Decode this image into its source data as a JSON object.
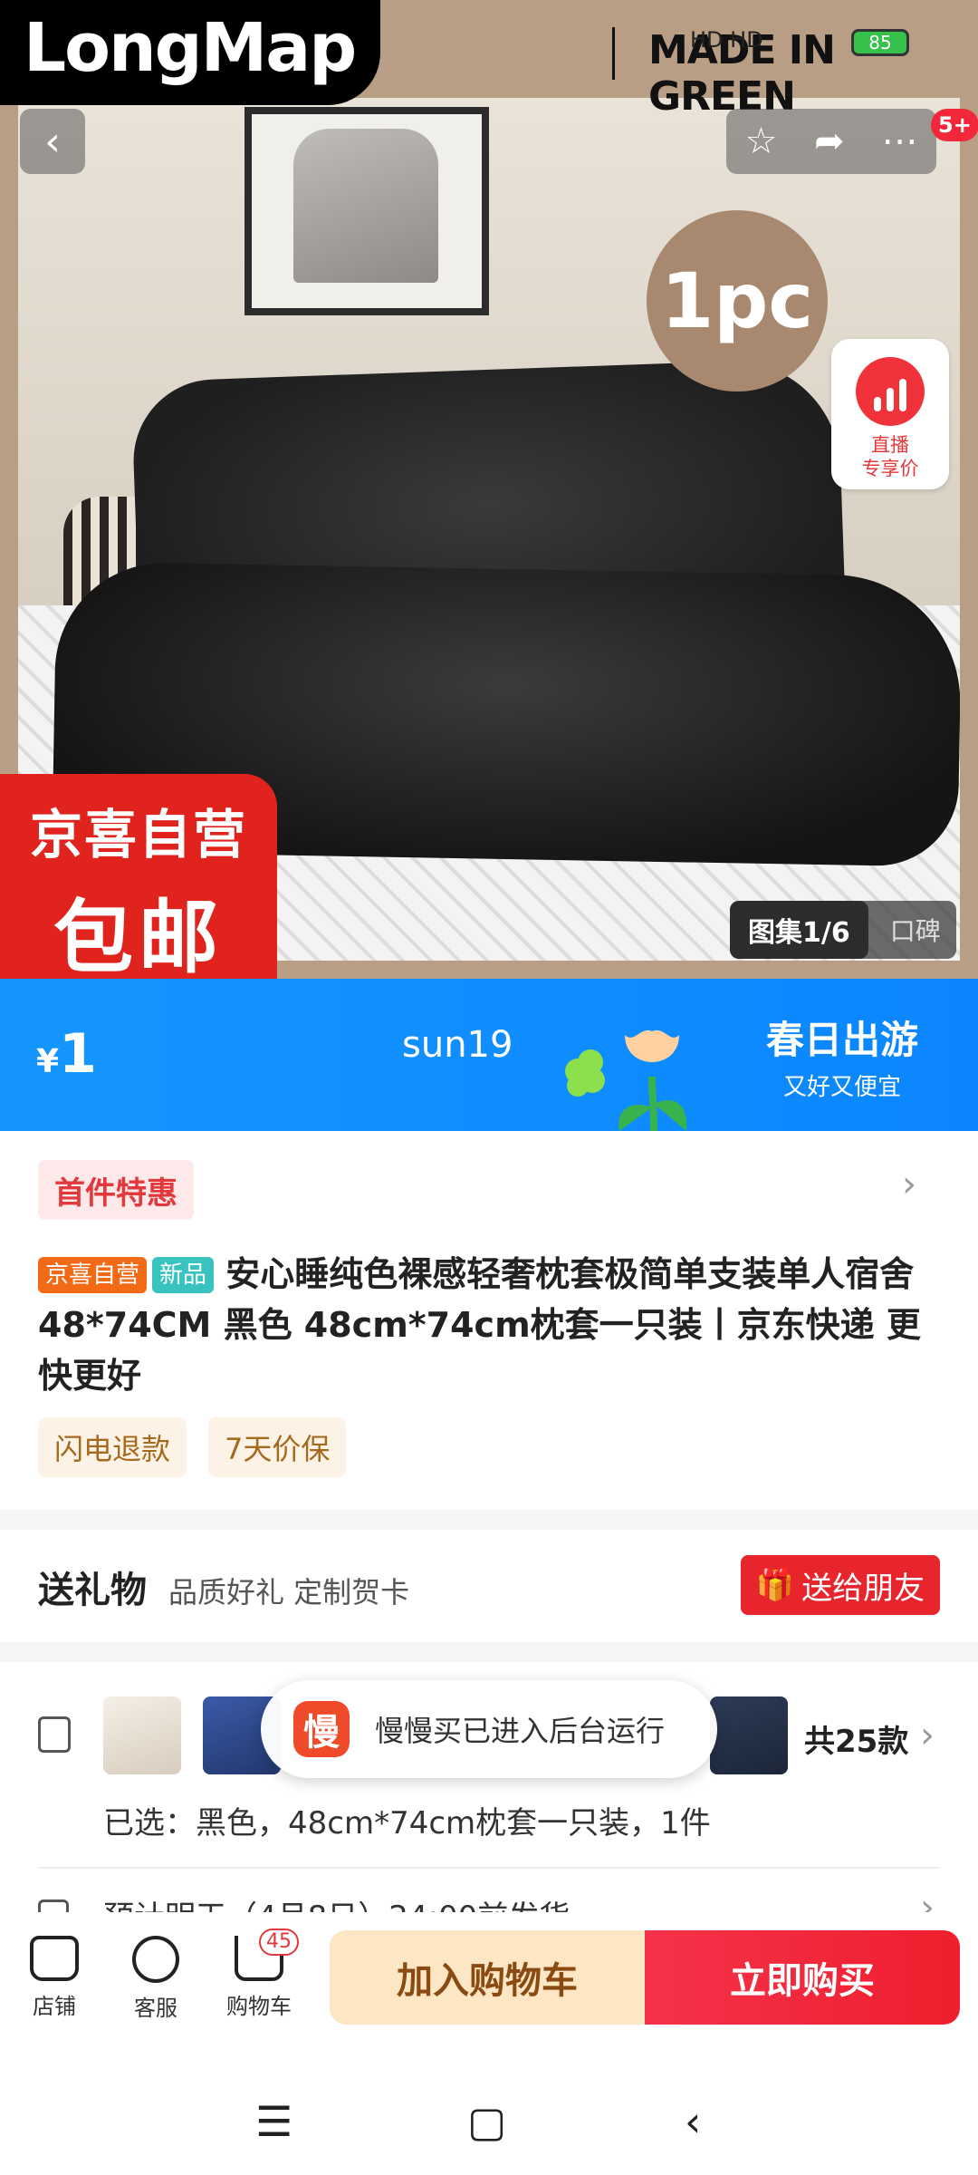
{
  "status_bar": {
    "logo_text": "LongMap",
    "made_in_green": "MADE IN GREEN",
    "network_icons": "HD HD",
    "battery": "85"
  },
  "header": {
    "notification_count": "5+"
  },
  "hero": {
    "badge_1pc": "1pc",
    "live_label_line1": "直播",
    "live_label_line2": "专享价",
    "jx_line1": "京喜自营",
    "jx_line2": "包邮",
    "gallery_label": "图集1/6",
    "reviews_label": "口碑"
  },
  "promo": {
    "currency": "¥",
    "price": "1",
    "user": "sun19",
    "event_title": "春日出游",
    "event_sub": "又好又便宜",
    "accent": "#1596ff"
  },
  "product": {
    "first_tag": "首件特惠",
    "tag_store": "京喜自营",
    "tag_new": "新品",
    "title": "安心睡纯色裸感轻奢枕套极简单支装单人宿舍48*74CM 黑色 48cm*74cm枕套一只装丨京东快递 更快更好",
    "service_1": "闪电退款",
    "service_2": "7天价保"
  },
  "gift": {
    "title": "送礼物",
    "subtitle": "品质好礼 定制贺卡",
    "button": "送给朋友"
  },
  "spec": {
    "count": "共25款",
    "selected": "已选：黑色，48cm*74cm枕套一只装，1件",
    "shipping": "预计明天（4月8日）24:00前发货"
  },
  "toast": {
    "app_icon": "慢",
    "text": "慢慢买已进入后台运行"
  },
  "bottom_bar": {
    "shop": "店铺",
    "service": "客服",
    "cart": "购物车",
    "cart_count": "45",
    "add_to_cart": "加入购物车",
    "buy_now": "立即购买",
    "buy_color": "#ee1f2e"
  }
}
